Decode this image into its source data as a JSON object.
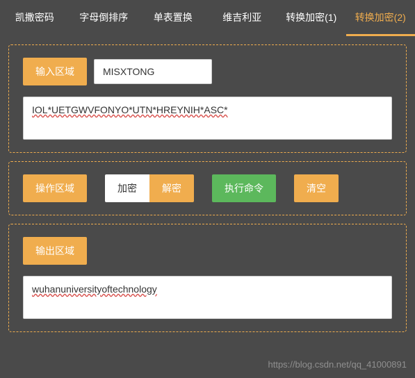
{
  "tabs": [
    {
      "label": "凯撒密码",
      "active": false
    },
    {
      "label": "字母倒排序",
      "active": false
    },
    {
      "label": "单表置换",
      "active": false
    },
    {
      "label": "维吉利亚",
      "active": false
    },
    {
      "label": "转换加密(1)",
      "active": false
    },
    {
      "label": "转换加密(2)",
      "active": true
    }
  ],
  "input_section": {
    "label": "输入区域",
    "key_value": "MISXTONG",
    "text_value": "IOL*UETGWVFONYO*UTN*HREYNIH*ASC*"
  },
  "ops_section": {
    "label": "操作区域",
    "encrypt": "加密",
    "decrypt": "解密",
    "execute": "执行命令",
    "clear": "清空"
  },
  "output_section": {
    "label": "输出区域",
    "text_value": "wuhanuniversityoftechnology"
  },
  "watermark": "https://blog.csdn.net/qq_41000891"
}
